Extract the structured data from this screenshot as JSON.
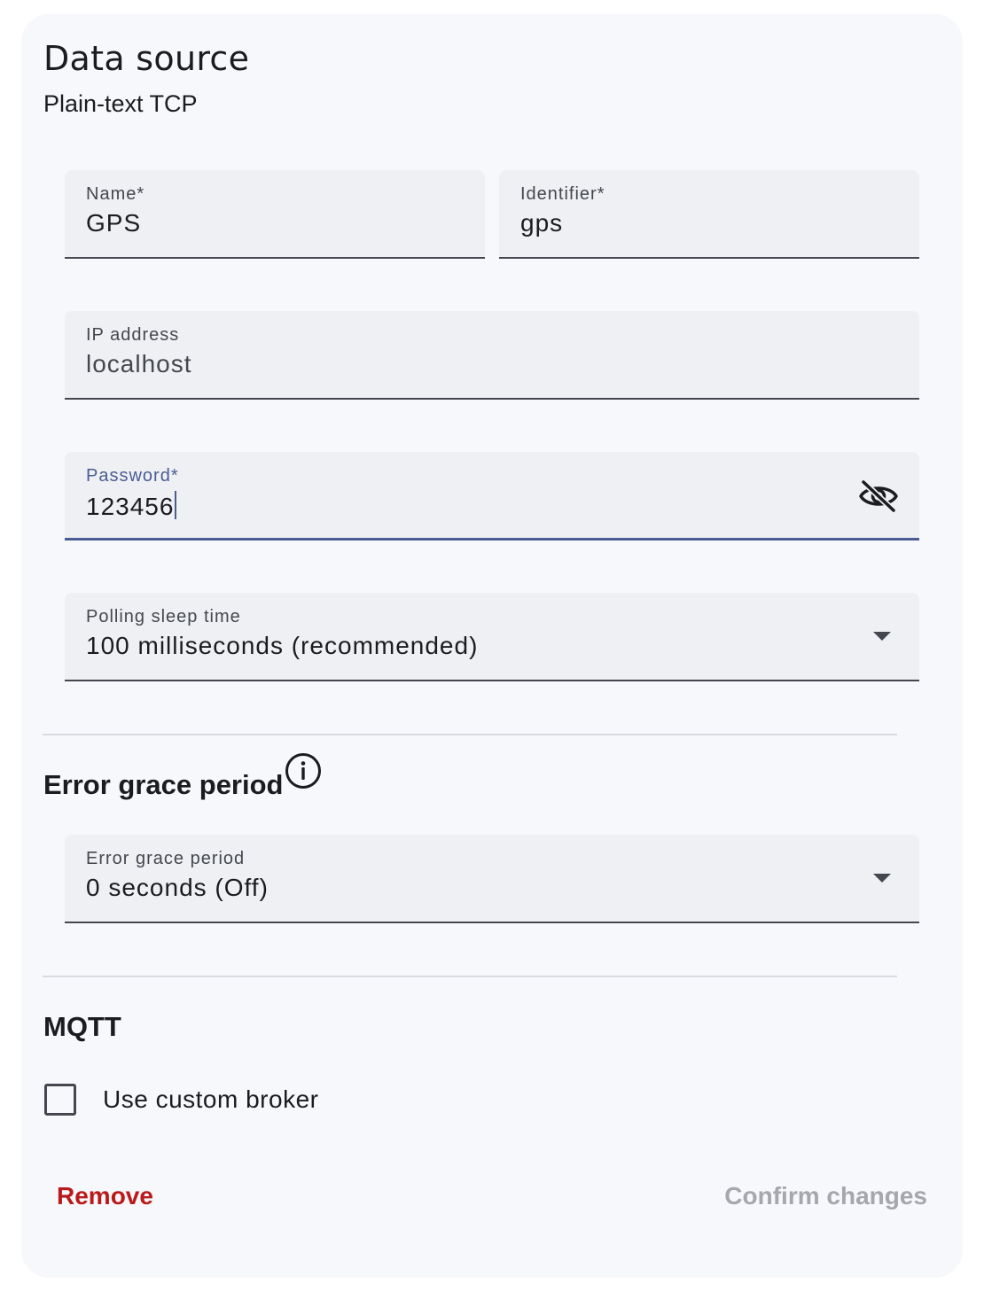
{
  "header": {
    "title": "Data source",
    "subtitle": "Plain-text TCP"
  },
  "fields": {
    "name": {
      "label": "Name*",
      "value": "GPS"
    },
    "identifier": {
      "label": "Identifier*",
      "value": "gps"
    },
    "ip_address": {
      "label": "IP address",
      "value": "localhost"
    },
    "password": {
      "label": "Password*",
      "value": "123456",
      "toggle_icon": "eye-off-icon"
    },
    "polling": {
      "label": "Polling sleep time",
      "value": "100 milliseconds (recommended)"
    }
  },
  "error_grace": {
    "section_title": "Error grace period",
    "info_icon": "info-icon",
    "field_label": "Error grace period",
    "field_value": "0 seconds (Off)"
  },
  "mqtt": {
    "section_title": "MQTT",
    "checkbox_label": "Use custom broker",
    "checked": false
  },
  "actions": {
    "remove_label": "Remove",
    "confirm_label": "Confirm changes"
  },
  "colors": {
    "accent": "#4a5c92",
    "danger": "#ba1a1a",
    "disabled": "#a5a7ad"
  }
}
